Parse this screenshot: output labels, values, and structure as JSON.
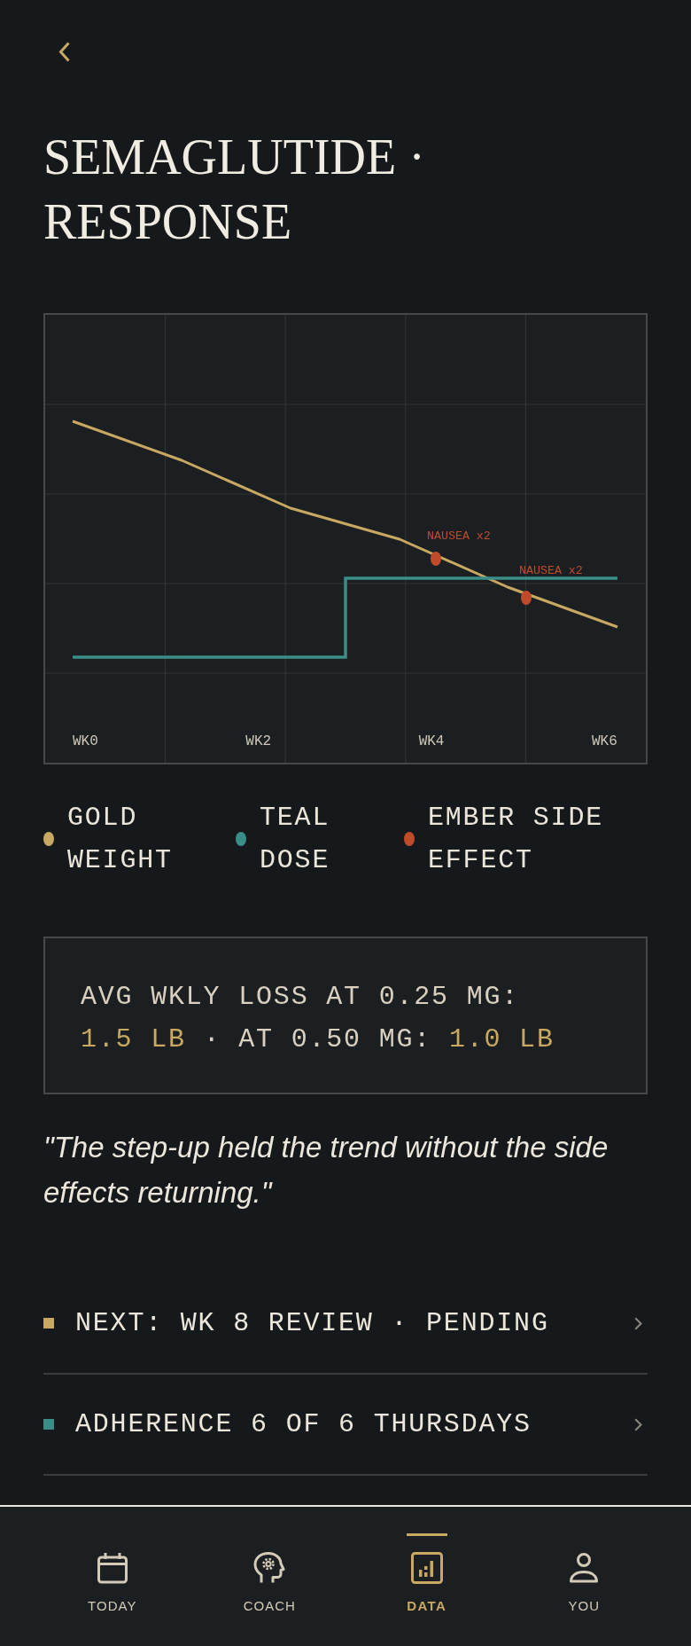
{
  "title": "SEMAGLUTIDE · RESPONSE",
  "chart": {
    "x_labels": [
      "WK0",
      "WK2",
      "WK4",
      "WK6"
    ],
    "annotations": [
      "NAUSEA x2",
      "NAUSEA x2"
    ]
  },
  "legend": [
    {
      "label": "GOLD WEIGHT",
      "color": "#c9a862"
    },
    {
      "label": "TEAL DOSE",
      "color": "#3b8e88"
    },
    {
      "label": "EMBER SIDE EFFECT",
      "color": "#c04b2b"
    }
  ],
  "stat": {
    "segments": [
      {
        "text": "AVG WKLY LOSS AT 0.25 MG: ",
        "highlight": false
      },
      {
        "text": "1.5 LB",
        "highlight": true
      },
      {
        "text": " · AT 0.50 MG: ",
        "highlight": false
      },
      {
        "text": "1.0 LB",
        "highlight": true
      }
    ]
  },
  "quote": "\"The step-up held the trend without the side effects returning.\"",
  "list": [
    {
      "label": "NEXT: WK 8 REVIEW · PENDING",
      "color": "#c9a862"
    },
    {
      "label": "ADHERENCE 6 OF 6 THURSDAYS",
      "color": "#3b8e88"
    }
  ],
  "navigation": {
    "items": [
      {
        "label": "TODAY",
        "selected": false
      },
      {
        "label": "COACH",
        "selected": false
      },
      {
        "label": "DATA",
        "selected": true
      },
      {
        "label": "YOU",
        "selected": false
      }
    ]
  }
}
